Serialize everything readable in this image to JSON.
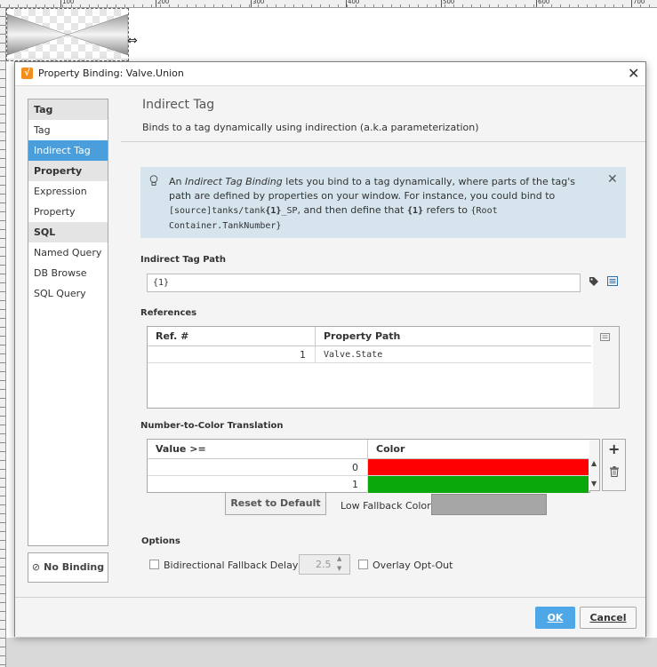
{
  "ruler": {
    "ticks": [
      "100",
      "200",
      "300",
      "400",
      "500",
      "600",
      "700"
    ]
  },
  "dialog": {
    "title": "Property Binding: Valve.Union",
    "icon_glyph": "√",
    "close_glyph": "✕"
  },
  "sidebar": {
    "groups": [
      {
        "header": "Tag",
        "items": [
          "Tag",
          "Indirect Tag"
        ]
      },
      {
        "header": "Property",
        "items": [
          "Expression",
          "Property"
        ]
      },
      {
        "header": "SQL",
        "items": [
          "Named Query",
          "DB Browse",
          "SQL Query"
        ]
      }
    ],
    "selected": "Indirect Tag",
    "no_binding_label": "No Binding"
  },
  "main": {
    "title": "Indirect Tag",
    "subtitle": "Binds to a tag dynamically using indirection (a.k.a parameterization)"
  },
  "info": {
    "t1": "An ",
    "t2": "Indirect Tag Binding",
    "t3": " lets you bind to a tag dynamically, where parts of the tag's path are defined by properties on your window. For instance, you could bind to",
    "m1": "[source]tanks/tank",
    "m2": "{1}",
    "m3": "_SP",
    "t4": ", and then define that ",
    "b1": "{1}",
    "t5": " refers to ",
    "m4": "{Root Container.TankNumber}"
  },
  "indirect_path": {
    "label": "Indirect Tag Path",
    "value": "{1}"
  },
  "references": {
    "label": "References",
    "columns": [
      "Ref. #",
      "Property Path"
    ],
    "rows": [
      {
        "ref": "1",
        "path": "Valve.State"
      }
    ]
  },
  "translation": {
    "label": "Number-to-Color Translation",
    "columns": [
      "Value >=",
      "Color"
    ],
    "rows": [
      {
        "value": "0",
        "color": "#ff0000"
      },
      {
        "value": "1",
        "color": "#0aa80a"
      }
    ],
    "reset_label": "Reset to Default",
    "fallback_label": "Low Fallback Color:",
    "fallback_color": "#a6a6a6"
  },
  "options": {
    "label": "Options",
    "bidirectional": "Bidirectional",
    "fallback_delay_label": "Fallback Delay",
    "fallback_delay_value": "2.5",
    "overlay_opt_out": "Overlay Opt-Out"
  },
  "footer": {
    "ok_label": "OK",
    "cancel_label": "Cancel"
  }
}
